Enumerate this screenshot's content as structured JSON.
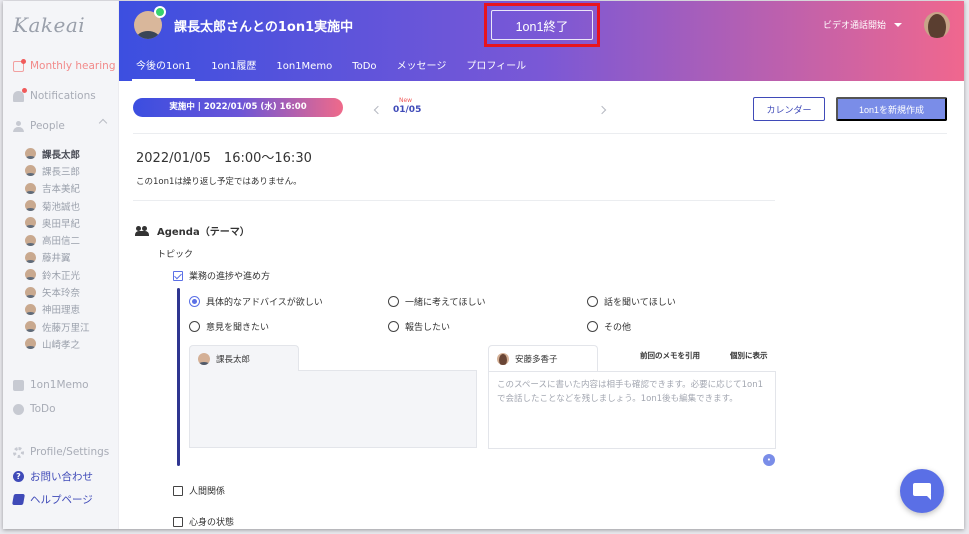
{
  "sidebar": {
    "logo": "Kakeai",
    "nav_monthly": "Monthly hearing",
    "nav_notifications": "Notifications",
    "nav_people": "People",
    "people": [
      "課長太郎",
      "課長三郎",
      "吉本美紀",
      "菊池誠也",
      "奥田早紀",
      "高田信二",
      "藤井翼",
      "鈴木正光",
      "矢本玲奈",
      "神田理恵",
      "佐藤万里江",
      "山崎孝之"
    ],
    "nav_memo": "1on1Memo",
    "nav_todo": "ToDo",
    "nav_profile": "Profile/Settings",
    "nav_contact": "お問い合わせ",
    "nav_help": "ヘルプページ"
  },
  "header": {
    "title": "課長太郎さんとの1on1実施中",
    "end_button": "1on1終了",
    "video": "ビデオ通話開始",
    "tabs": [
      "今後の1on1",
      "1on1履歴",
      "1on1Memo",
      "ToDo",
      "メッセージ",
      "プロフィール"
    ]
  },
  "toolbar": {
    "status_pill": "実施中 | 2022/01/05 (水) 16:00",
    "new_badge": "New",
    "current_date": "01/05",
    "calendar_button": "カレンダー",
    "create_button": "1on1を新規作成"
  },
  "meeting": {
    "datetime": "2022/01/05　16:00〜16:30",
    "repeat_note": "この1on1は繰り返し予定ではありません。"
  },
  "agenda": {
    "heading": "Agenda（テーマ）",
    "topic_label": "トピック",
    "topic1": "業務の進捗や進め方",
    "options": [
      "具体的なアドバイスが欲しい",
      "一緒に考えてほしい",
      "話を聞いてほしい",
      "意見を聞きたい",
      "報告したい",
      "その他"
    ],
    "topic2": "人間関係",
    "topic3": "心身の状態"
  },
  "memo": {
    "left_name": "課長太郎",
    "right_name": "安藤多香子",
    "quote_prev": "前回のメモを引用",
    "show_separate": "個別に表示",
    "placeholder": "このスペースに書いた内容は相手も確認できます。必要に応じて1on1で会話したことなどを残しましょう。1on1後も編集できます。"
  },
  "colors": {
    "accent": "#3f4ab8",
    "gradient_start": "#3c4fe0",
    "gradient_end": "#f0678e",
    "highlight": "#e8141e",
    "monthly": "#f28a8a"
  }
}
